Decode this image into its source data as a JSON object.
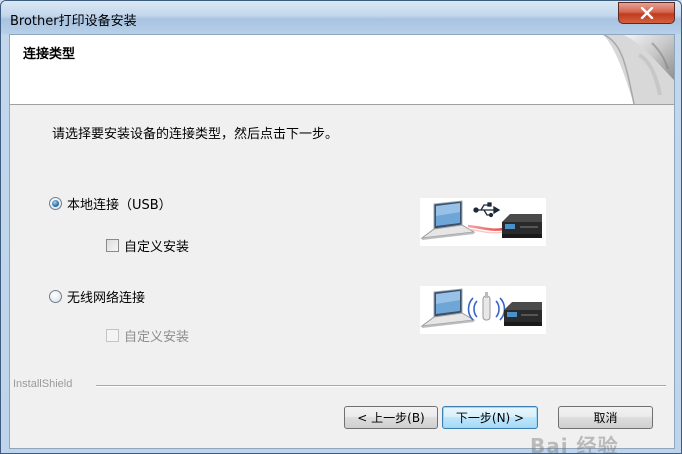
{
  "window": {
    "title": "Brother打印设备安装"
  },
  "header": {
    "title": "连接类型"
  },
  "instruction": "请选择要安装设备的连接类型，然后点击下一步。",
  "options": {
    "usb": {
      "label": "本地连接（USB）",
      "selected": true,
      "custom_install_label": "自定义安装",
      "custom_install_checked": false,
      "custom_install_enabled": true,
      "illustration": "laptop-usb-printer"
    },
    "wireless": {
      "label": "无线网络连接",
      "selected": false,
      "custom_install_label": "自定义安装",
      "custom_install_checked": false,
      "custom_install_enabled": false,
      "illustration": "laptop-wireless-printer"
    }
  },
  "footer": {
    "brand": "InstallShield",
    "back_label": "< 上一步(B)",
    "next_label": "下一步(N) >",
    "cancel_label": "取消",
    "watermark": "Bai 经验"
  },
  "colors": {
    "close_button": "#c23b1e",
    "default_button_border": "#3c7fb1",
    "usb_cable": "#e84a4a",
    "wireless_waves": "#3a66c8"
  }
}
